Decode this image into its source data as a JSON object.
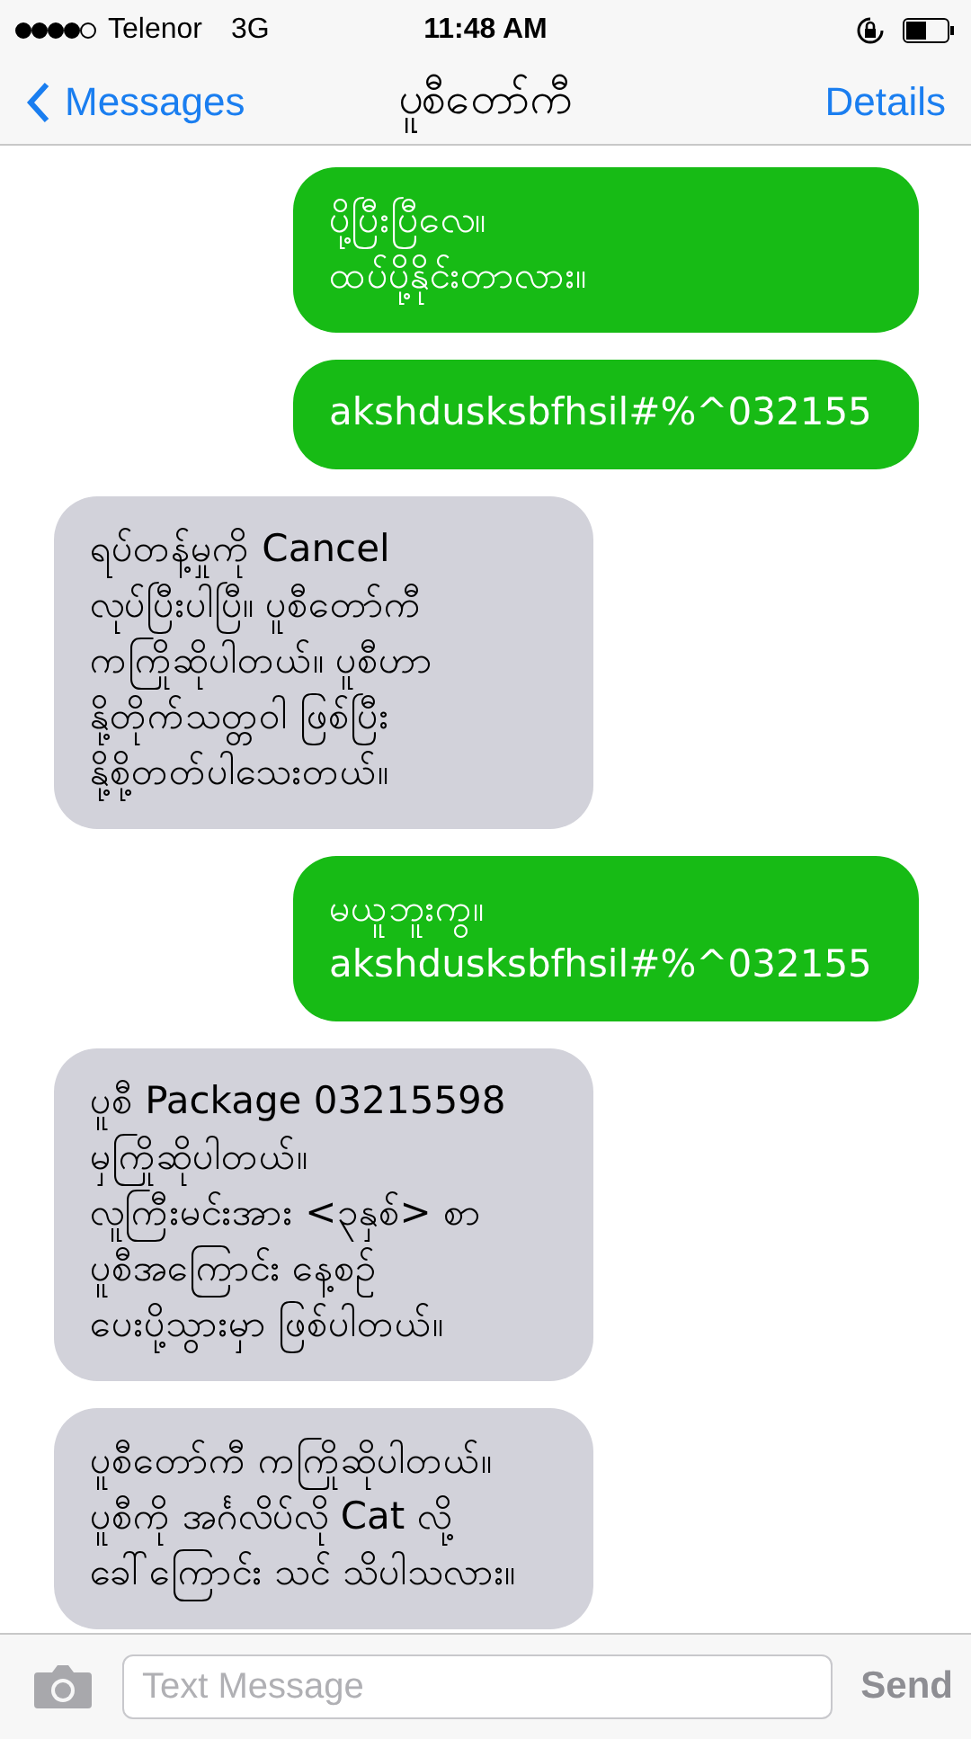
{
  "status_bar": {
    "carrier": "Telenor",
    "network": "3G",
    "time": "11:48 AM"
  },
  "nav_bar": {
    "back": "Messages",
    "title": "ပူစီတော်ကီ",
    "action": "Details"
  },
  "messages": [
    {
      "kind": "outgoing",
      "lines": [
        "ပို့ပြီးပြီလေ။",
        "ထပ်ပို့နိုင်းတာလား။"
      ]
    },
    {
      "kind": "outgoing",
      "lines": [
        "akshdusksbfhsil#%^032155"
      ]
    },
    {
      "kind": "incoming",
      "lines": [
        "ရပ်တန့်မှုကို Cancel",
        "လုပ်ပြီးပါပြီ။ ပူစီတော်ကီ",
        "ကကြိုဆိုပါတယ်။ ပူစီဟာ",
        "နို့တိုက်သတ္တဝါ ဖြစ်ပြီး",
        "နို့စို့တတ်ပါသေးတယ်။"
      ]
    },
    {
      "kind": "outgoing",
      "lines": [
        "မယူဘူးကွ။",
        "akshdusksbfhsil#%^032155"
      ]
    },
    {
      "kind": "incoming",
      "lines": [
        "ပူစီ Package 03215598",
        "မှကြိုဆိုပါတယ်။",
        "လူကြီးမင်းအား <၃နှစ်> စာ",
        "ပူစီအကြောင်း နေ့စဉ်",
        "ပေးပို့သွားမှာ ဖြစ်ပါတယ်။"
      ]
    },
    {
      "kind": "incoming",
      "lines": [
        "ပူစီတော်ကီ ကကြိုဆိုပါတယ်။",
        "ပူစီကို အင်္ဂလိပ်လို Cat လို့",
        "ခေါ်ကြောင်း သင် သိပါသလား။"
      ]
    }
  ],
  "composer": {
    "placeholder": "Text Message",
    "send": "Send"
  }
}
